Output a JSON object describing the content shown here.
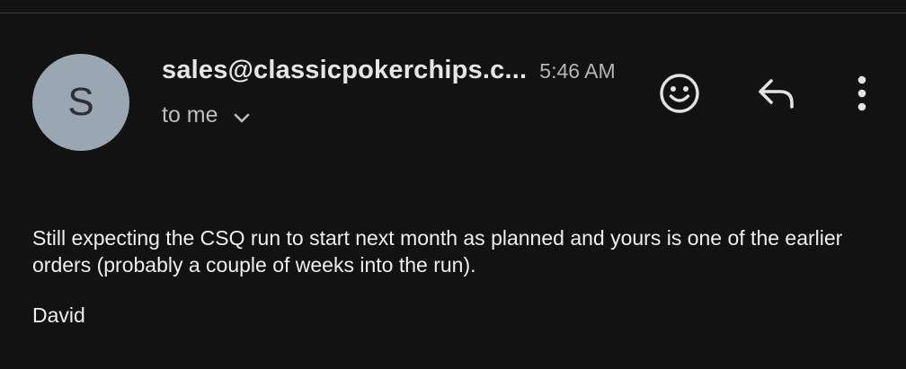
{
  "message": {
    "avatar_initial": "S",
    "sender": "sales@classicpokerchips.c...",
    "time": "5:46 AM",
    "recipient": "to me",
    "body_text": "Still expecting the CSQ run to start next month as planned and yours is one of the earlier orders (probably a couple of weeks into the run).",
    "signature": "David"
  },
  "actions": {
    "emoji_icon": "emoji-reaction-icon",
    "reply_icon": "reply-icon",
    "more_icon": "more-vert-icon"
  },
  "colors": {
    "background": "#121212",
    "avatar_bg": "#9aa7b3",
    "text": "#e3e3e3"
  }
}
